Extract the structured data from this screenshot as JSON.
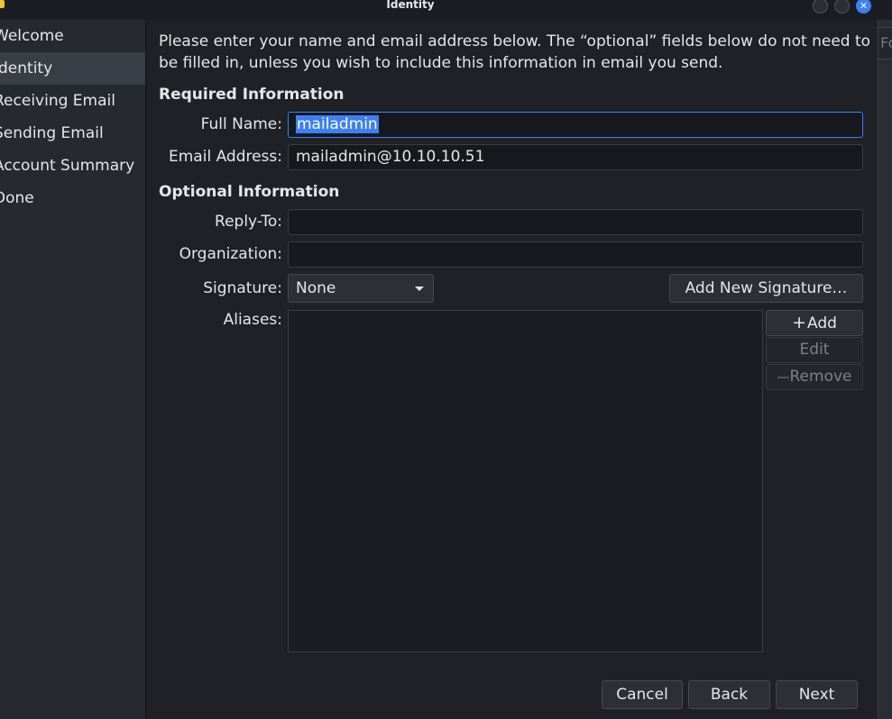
{
  "window": {
    "title": "Identity",
    "close_glyph": "✕"
  },
  "sidebar": {
    "items": [
      {
        "label": "Welcome"
      },
      {
        "label": "Identity"
      },
      {
        "label": "Receiving Email"
      },
      {
        "label": "Sending Email"
      },
      {
        "label": "Account Summary"
      },
      {
        "label": "Done"
      }
    ],
    "active_index": 1
  },
  "right_strip_text": "Fo",
  "main": {
    "intro": "Please enter your name and email address below. The “optional” fields below do not need to be filled in, unless you wish to include this information in email you send.",
    "required_heading": "Required Information",
    "optional_heading": "Optional Information",
    "full_name_label": "Full Name:",
    "full_name_value": "mailadmin",
    "email_label": "Email Address:",
    "email_value": "mailadmin@10.10.10.51",
    "reply_to_label": "Reply-To:",
    "reply_to_value": "",
    "organization_label": "Organization:",
    "organization_value": "",
    "signature_label": "Signature:",
    "signature_selected": "None",
    "add_signature_label": "Add New Signature…",
    "aliases_label": "Aliases:",
    "add_alias_label": "Add",
    "add_alias_glyph": "+",
    "edit_alias_label": "Edit",
    "remove_alias_label": "Remove",
    "remove_alias_glyph": "—"
  },
  "footer": {
    "cancel_label": "Cancel",
    "back_label": "Back",
    "next_label": "Next"
  },
  "colors": {
    "accent": "#3d7ff7",
    "background": "#1f2126",
    "sidebar": "#262930"
  }
}
